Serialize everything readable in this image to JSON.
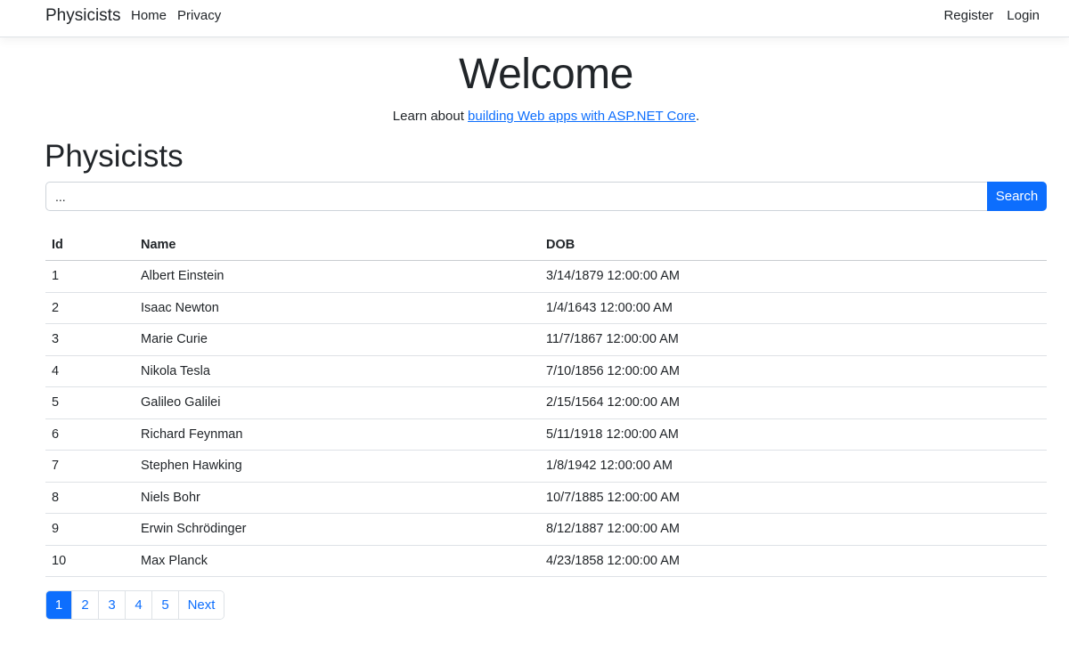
{
  "nav": {
    "brand": "Physicists",
    "left_links": [
      "Home",
      "Privacy"
    ],
    "right_links": [
      "Register",
      "Login"
    ]
  },
  "hero": {
    "title": "Welcome",
    "learn_prefix": "Learn about ",
    "learn_link": "building Web apps with ASP.NET Core",
    "learn_suffix": "."
  },
  "main": {
    "heading": "Physicists",
    "search": {
      "value": "...",
      "placeholder": "",
      "button_label": "Search"
    }
  },
  "table": {
    "headers": [
      "Id",
      "Name",
      "DOB"
    ],
    "rows": [
      [
        "1",
        "Albert Einstein",
        "3/14/1879 12:00:00 AM"
      ],
      [
        "2",
        "Isaac Newton",
        "1/4/1643 12:00:00 AM"
      ],
      [
        "3",
        "Marie Curie",
        "11/7/1867 12:00:00 AM"
      ],
      [
        "4",
        "Nikola Tesla",
        "7/10/1856 12:00:00 AM"
      ],
      [
        "5",
        "Galileo Galilei",
        "2/15/1564 12:00:00 AM"
      ],
      [
        "6",
        "Richard Feynman",
        "5/11/1918 12:00:00 AM"
      ],
      [
        "7",
        "Stephen Hawking",
        "1/8/1942 12:00:00 AM"
      ],
      [
        "8",
        "Niels Bohr",
        "10/7/1885 12:00:00 AM"
      ],
      [
        "9",
        "Erwin Schrödinger",
        "8/12/1887 12:00:00 AM"
      ],
      [
        "10",
        "Max Planck",
        "4/23/1858 12:00:00 AM"
      ]
    ]
  },
  "pagination": {
    "pages": [
      "1",
      "2",
      "3",
      "4",
      "5"
    ],
    "active": "1",
    "next_label": "Next"
  },
  "colors": {
    "primary": "#0d6efd",
    "text": "#212529",
    "border": "#dee2e6"
  }
}
